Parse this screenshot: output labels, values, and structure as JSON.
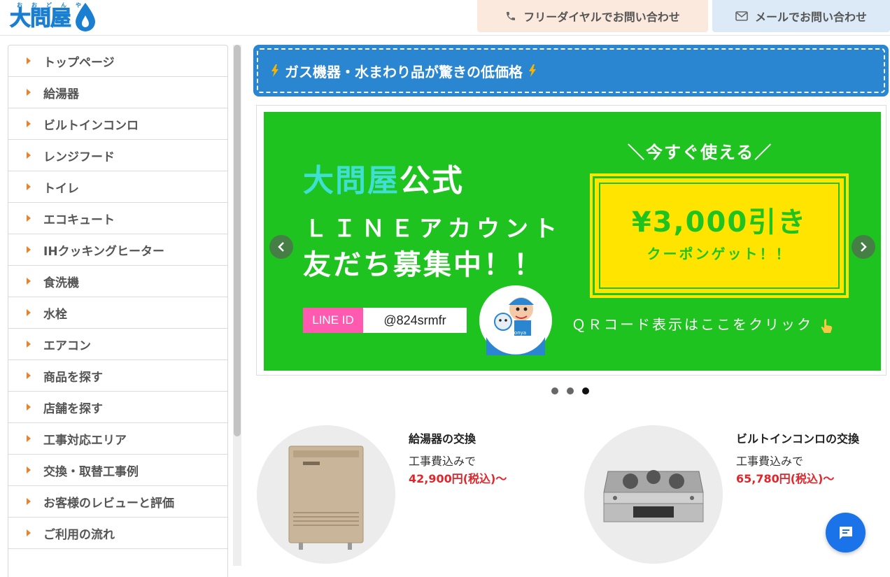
{
  "header": {
    "logo_text": "大問屋",
    "logo_ruby": "おおどんや",
    "phone_label": "フリーダイヤルでお問い合わせ",
    "mail_label": "メールでお問い合わせ"
  },
  "sidebar": {
    "items": [
      {
        "label": "トップページ"
      },
      {
        "label": "給湯器"
      },
      {
        "label": "ビルトインコンロ"
      },
      {
        "label": "レンジフード"
      },
      {
        "label": "トイレ"
      },
      {
        "label": "エコキュート"
      },
      {
        "label": "IHクッキングヒーター"
      },
      {
        "label": "食洗機"
      },
      {
        "label": "水栓"
      },
      {
        "label": "エアコン"
      },
      {
        "label": "商品を探す"
      },
      {
        "label": "店舗を探す"
      },
      {
        "label": "工事対応エリア"
      },
      {
        "label": "交換・取替工事例"
      },
      {
        "label": "お客様のレビューと評価"
      },
      {
        "label": "ご利用の流れ"
      }
    ]
  },
  "banner": {
    "title": "ガス機器・水まわり品が驚きの低価格"
  },
  "slide": {
    "brand": "大問屋",
    "official": "公式",
    "line_account": "ＬＩＮＥアカウント",
    "recruit": "友だち募集中！！",
    "line_id_label": "LINE ID",
    "line_id_value": "@824srmfr",
    "now_usable": "＼今すぐ使える／",
    "discount": "¥3,000引き",
    "coupon_get": "クーポンゲット！！",
    "qr_text": "ＱＲコード表示はここをクリック",
    "mascot_romaji": "oodonya",
    "mascot_name": "大問屋"
  },
  "slider_dots": {
    "count": 3,
    "active_index": 2
  },
  "products": [
    {
      "name": "給湯器の交換",
      "sub": "工事費込みで",
      "price": "42,900円(税込)〜"
    },
    {
      "name": "ビルトインコンロの交換",
      "sub": "工事費込みで",
      "price": "65,780円(税込)〜"
    }
  ],
  "colors": {
    "brand_blue": "#1a7fd0",
    "banner_blue": "#2a86d1",
    "accent_orange": "#e8822c",
    "line_green": "#1ec31f",
    "coupon_yellow": "#ffe400",
    "price_red": "#e0262b"
  },
  "icons": {
    "phone": "phone-icon",
    "mail": "envelope-icon",
    "bolt": "lightning-icon",
    "chat": "chat-bubble-icon"
  }
}
